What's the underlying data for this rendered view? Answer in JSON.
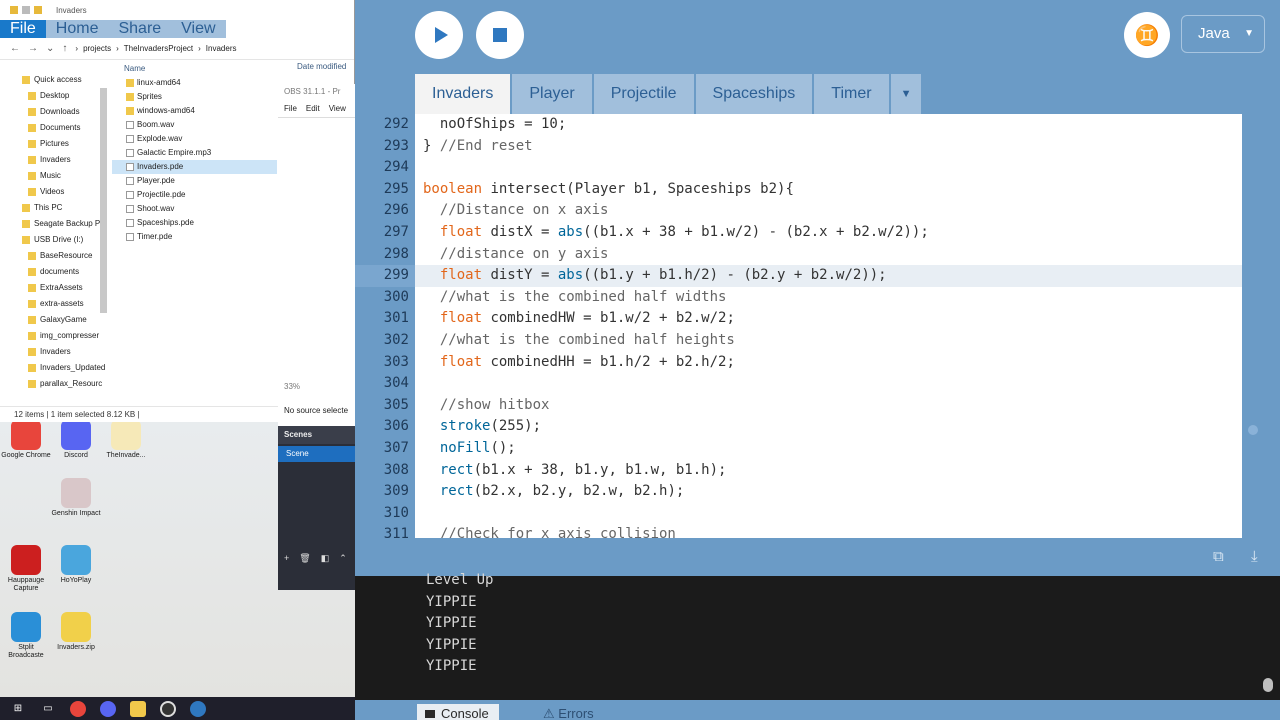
{
  "explorer": {
    "window_title": "Invaders",
    "ribbon_tabs": [
      "File",
      "Home",
      "Share",
      "View"
    ],
    "address_path": [
      "projects",
      "TheInvadersProject",
      "Invaders"
    ],
    "nav_items": [
      {
        "label": "Quick access",
        "level": "root"
      },
      {
        "label": "Desktop",
        "level": "sub"
      },
      {
        "label": "Downloads",
        "level": "sub"
      },
      {
        "label": "Documents",
        "level": "sub"
      },
      {
        "label": "Pictures",
        "level": "sub"
      },
      {
        "label": "Invaders",
        "level": "sub"
      },
      {
        "label": "Music",
        "level": "sub"
      },
      {
        "label": "Videos",
        "level": "sub"
      },
      {
        "label": "This PC",
        "level": "root"
      },
      {
        "label": "Seagate Backup P",
        "level": "root"
      },
      {
        "label": "USB Drive (I:)",
        "level": "root"
      },
      {
        "label": "BaseResource",
        "level": "sub"
      },
      {
        "label": "documents",
        "level": "sub"
      },
      {
        "label": "ExtraAssets",
        "level": "sub"
      },
      {
        "label": "extra-assets",
        "level": "sub"
      },
      {
        "label": "GalaxyGame",
        "level": "sub"
      },
      {
        "label": "img_compresser",
        "level": "sub"
      },
      {
        "label": "Invaders",
        "level": "sub"
      },
      {
        "label": "Invaders_Updated",
        "level": "sub"
      },
      {
        "label": "parallax_Resourc",
        "level": "sub"
      }
    ],
    "column_name": "Name",
    "column_date": "Date modified",
    "files": [
      {
        "name": "linux-amd64",
        "type": "folder"
      },
      {
        "name": "Sprites",
        "type": "folder"
      },
      {
        "name": "windows-amd64",
        "type": "folder"
      },
      {
        "name": "Boom.wav",
        "type": "file"
      },
      {
        "name": "Explode.wav",
        "type": "file"
      },
      {
        "name": "Galactic Empire.mp3",
        "type": "file"
      },
      {
        "name": "Invaders.pde",
        "type": "file",
        "selected": true
      },
      {
        "name": "Player.pde",
        "type": "file"
      },
      {
        "name": "Projectile.pde",
        "type": "file"
      },
      {
        "name": "Shoot.wav",
        "type": "file"
      },
      {
        "name": "Spaceships.pde",
        "type": "file"
      },
      {
        "name": "Timer.pde",
        "type": "file"
      }
    ],
    "status": "12 items  |  1 item selected  8.12 KB  |"
  },
  "obs": {
    "title": "OBS 31.1.1 - Pr",
    "menu": [
      "File",
      "Edit",
      "View"
    ],
    "zoom": "33%",
    "no_source": "No source selecte",
    "scenes_header": "Scenes",
    "scene_item": "Scene"
  },
  "desktop_icons": [
    {
      "label": "Google Chrome",
      "color": "#e8453c"
    },
    {
      "label": "Discord",
      "color": "#5865f2"
    },
    {
      "label": "TheInvade...",
      "color": "#f6e9b8"
    },
    {
      "label": "Genshin Impact",
      "color": "#d9c7c9"
    },
    {
      "label": "Hauppauge Capture",
      "color": "#cc1f1f"
    },
    {
      "label": "HoYoPlay",
      "color": "#4aa6dd"
    },
    {
      "label": "Stplit Broadcaste",
      "color": "#2a8fd7"
    },
    {
      "label": "Invaders.zip",
      "color": "#f1d04a"
    }
  ],
  "ide": {
    "mode": "Java",
    "tabs": [
      "Invaders",
      "Player",
      "Projectile",
      "Spaceships",
      "Timer"
    ],
    "active_tab": "Invaders",
    "code_lines": [
      {
        "num": "292",
        "html": "  noOfShips = 10;"
      },
      {
        "num": "293",
        "html": "} <span class=\"cm\">//End reset</span>"
      },
      {
        "num": "294",
        "html": ""
      },
      {
        "num": "295",
        "html": "<span class=\"kw\">boolean</span> intersect(Player b1, Spaceships b2){"
      },
      {
        "num": "296",
        "html": "  <span class=\"cm\">//Distance on x axis</span>"
      },
      {
        "num": "297",
        "html": "  <span class=\"kw\">float</span> distX = <span class=\"fn\">abs</span>((b1.x + 38 + b1.w/2) - (b2.x + b2.w/2));"
      },
      {
        "num": "298",
        "html": "  <span class=\"cm\">//distance on y axis</span>"
      },
      {
        "num": "299",
        "html": "  <span class=\"kw\">float</span> distY = <span class=\"fn\">abs</span>((b1.y + b1.h/2) - (b2.y + b2.w/2));"
      },
      {
        "num": "300",
        "html": "  <span class=\"cm\">//what is the combined half widths</span>"
      },
      {
        "num": "301",
        "html": "  <span class=\"kw\">float</span> combinedHW = b1.w/2 + b2.w/2;"
      },
      {
        "num": "302",
        "html": "  <span class=\"cm\">//what is the combined half heights</span>"
      },
      {
        "num": "303",
        "html": "  <span class=\"kw\">float</span> combinedHH = b1.h/2 + b2.h/2;"
      },
      {
        "num": "304",
        "html": ""
      },
      {
        "num": "305",
        "html": "  <span class=\"cm\">//show hitbox</span>"
      },
      {
        "num": "306",
        "html": "  <span class=\"fn\">stroke</span>(255);"
      },
      {
        "num": "307",
        "html": "  <span class=\"fn\">noFill</span>();"
      },
      {
        "num": "308",
        "html": "  <span class=\"fn\">rect</span>(b1.x + 38, b1.y, b1.w, b1.h);"
      },
      {
        "num": "309",
        "html": "  <span class=\"fn\">rect</span>(b2.x, b2.y, b2.w, b2.h);"
      },
      {
        "num": "310",
        "html": ""
      },
      {
        "num": "311",
        "html": "  <span class=\"cm\">//Check for x axis collision</span>"
      }
    ],
    "current_line": "299",
    "console_lines": [
      "Level Up",
      "YIPPIE",
      "YIPPIE",
      "YIPPIE",
      "YIPPIE"
    ],
    "bottom_tabs": [
      "Console",
      "Errors"
    ]
  }
}
